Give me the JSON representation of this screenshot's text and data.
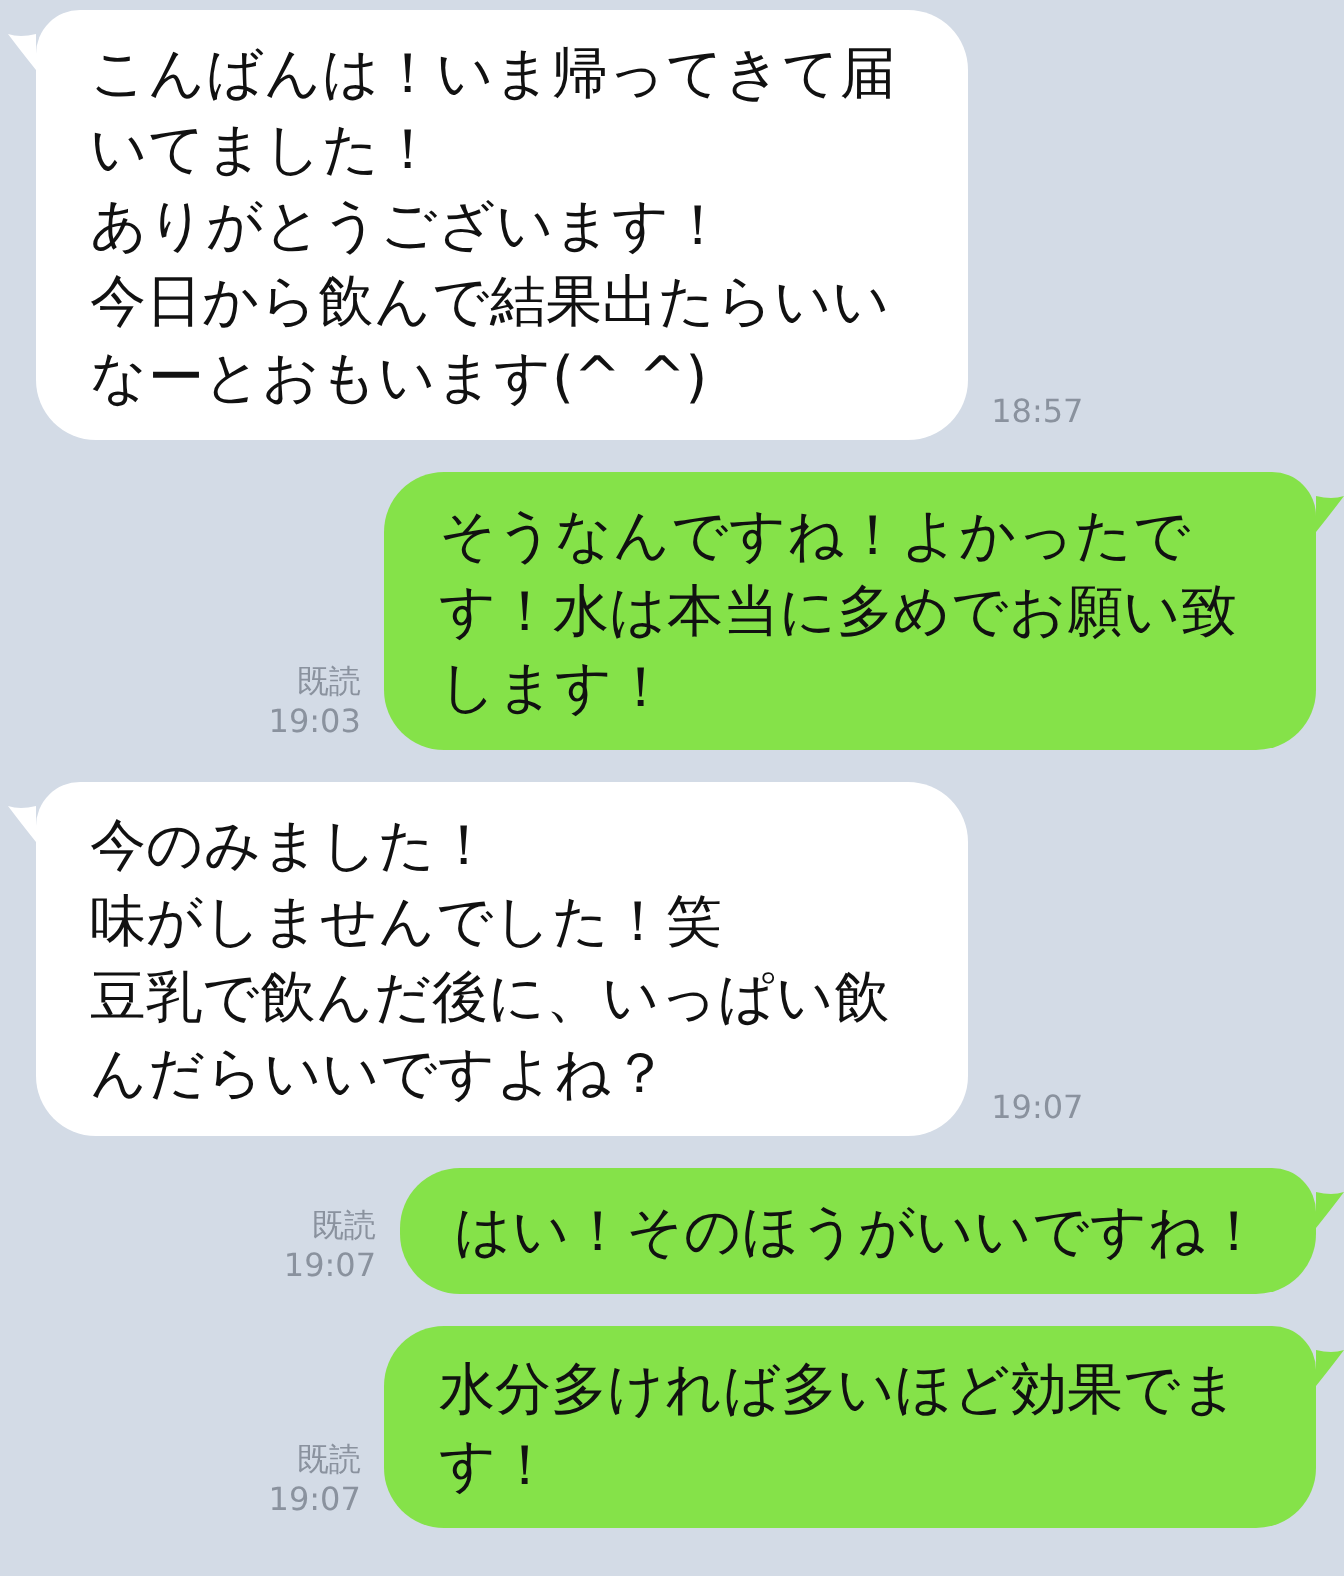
{
  "messages": [
    {
      "kind": "incoming",
      "lines": [
        "こんばんは！いま帰ってきて届いてました！",
        "ありがとうございます！",
        "今日から飲んで結果出たらいいなーとおもいます(^ ^)"
      ],
      "time": "18:57"
    },
    {
      "kind": "outgoing",
      "lines": [
        "そうなんですね！よかったです！水は本当に多めでお願い致します！"
      ],
      "read_label": "既読",
      "time": "19:03"
    },
    {
      "kind": "incoming",
      "lines": [
        "今のみました！",
        "味がしませんでした！笑",
        "豆乳で飲んだ後に、いっぱい飲んだらいいですよね？"
      ],
      "time": "19:07"
    },
    {
      "kind": "outgoing",
      "lines": [
        "はい！そのほうがいいですね！"
      ],
      "read_label": "既読",
      "time": "19:07"
    },
    {
      "kind": "outgoing",
      "lines": [
        "水分多ければ多いほど効果でます！"
      ],
      "read_label": "既読",
      "time": "19:07"
    }
  ]
}
